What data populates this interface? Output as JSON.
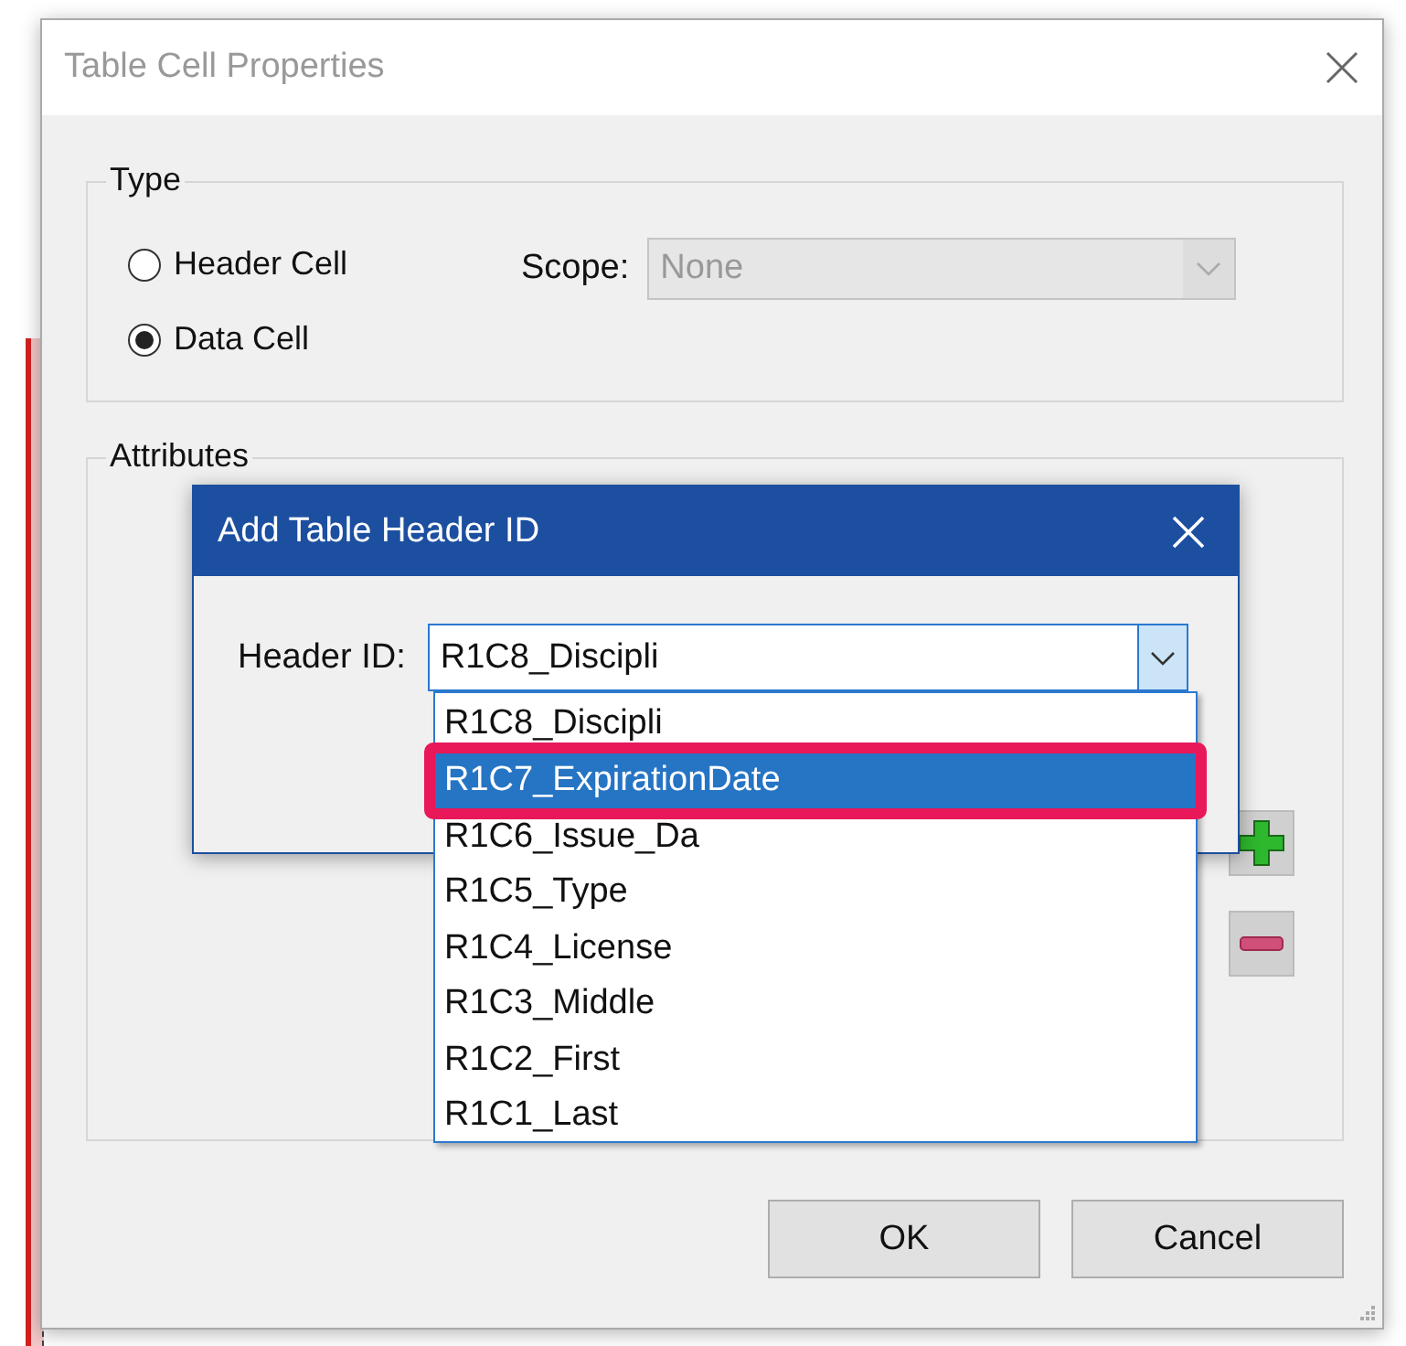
{
  "dialog": {
    "title": "Table Cell Properties",
    "type_group": {
      "label": "Type",
      "options": [
        {
          "label": "Header Cell",
          "selected": false
        },
        {
          "label": "Data Cell",
          "selected": true
        }
      ],
      "scope": {
        "label": "Scope:",
        "value": "None",
        "disabled": true
      }
    },
    "attributes_group": {
      "label": "Attributes"
    },
    "buttons": [
      {
        "label": "OK"
      },
      {
        "label": "Cancel"
      }
    ]
  },
  "add_header_dialog": {
    "title": "Add Table Header ID",
    "field_label": "Header ID:",
    "value": "R1C8_Discipli",
    "options": [
      {
        "label": "R1C8_Discipli",
        "highlighted": false
      },
      {
        "label": "R1C7_ExpirationDate",
        "highlighted": true
      },
      {
        "label": "R1C6_Issue_Da",
        "highlighted": false
      },
      {
        "label": "R1C5_Type",
        "highlighted": false
      },
      {
        "label": "R1C4_License",
        "highlighted": false
      },
      {
        "label": "R1C3_Middle",
        "highlighted": false
      },
      {
        "label": "R1C2_First",
        "highlighted": false
      },
      {
        "label": "R1C1_Last",
        "highlighted": false
      }
    ]
  }
}
